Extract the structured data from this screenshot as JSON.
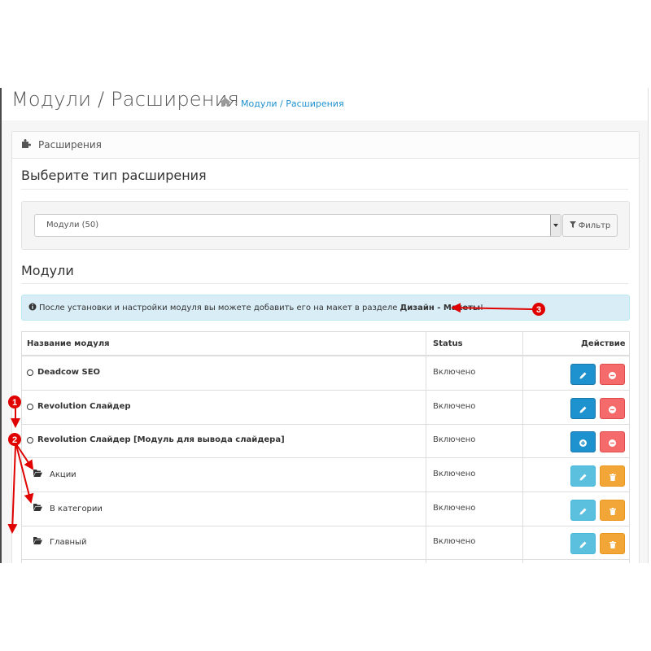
{
  "page": {
    "title": "Модули / Расширения",
    "breadcrumb": [
      "Модули / Расширения"
    ]
  },
  "panel": {
    "heading": "Расширения"
  },
  "filter": {
    "section_title": "Выберите тип расширения",
    "select_value": "Модули (50)",
    "filter_button_label": "Фильтр"
  },
  "modules": {
    "section_title": "Модули",
    "alert": {
      "text_before": "После установки и настройки модуля вы можете добавить его на макет в разделе",
      "bold_text": "Дизайн - Макеты",
      "text_after": "!"
    },
    "table": {
      "headers": [
        "Название модуля",
        "Status",
        "Действие"
      ],
      "rows": [
        {
          "name": "Deadcow SEO",
          "status": "Включено"
        },
        {
          "name": "Revolution Слайдер",
          "status": "Включено"
        },
        {
          "name": "Revolution Слайдер [Модуль для вывода слайдера]",
          "status": "Включено"
        },
        {
          "name": "Акции",
          "status": "Включено"
        },
        {
          "name": "В категории",
          "status": "Включено"
        },
        {
          "name": "Главный",
          "status": "Включено"
        }
      ]
    }
  },
  "annotations": {
    "markers": [
      "1",
      "2",
      "3"
    ]
  },
  "icons": {
    "breadcrumb": "home-icon",
    "panel": "puzzle-icon",
    "filter": "filter-icon",
    "alert": "info-circle-icon",
    "edit": "pencil-icon",
    "delete": "minus-circle-icon",
    "install": "plus-circle-icon",
    "remove_child": "trash-icon",
    "folder": "folder-open-icon"
  },
  "colors": {
    "link": "#1e91cf",
    "primary": "#1e91cf",
    "danger": "#f56b6b",
    "info": "#5bc0de",
    "warning": "#f3a638",
    "alert_bg": "#d9edf7",
    "annotation": "#e00000"
  }
}
